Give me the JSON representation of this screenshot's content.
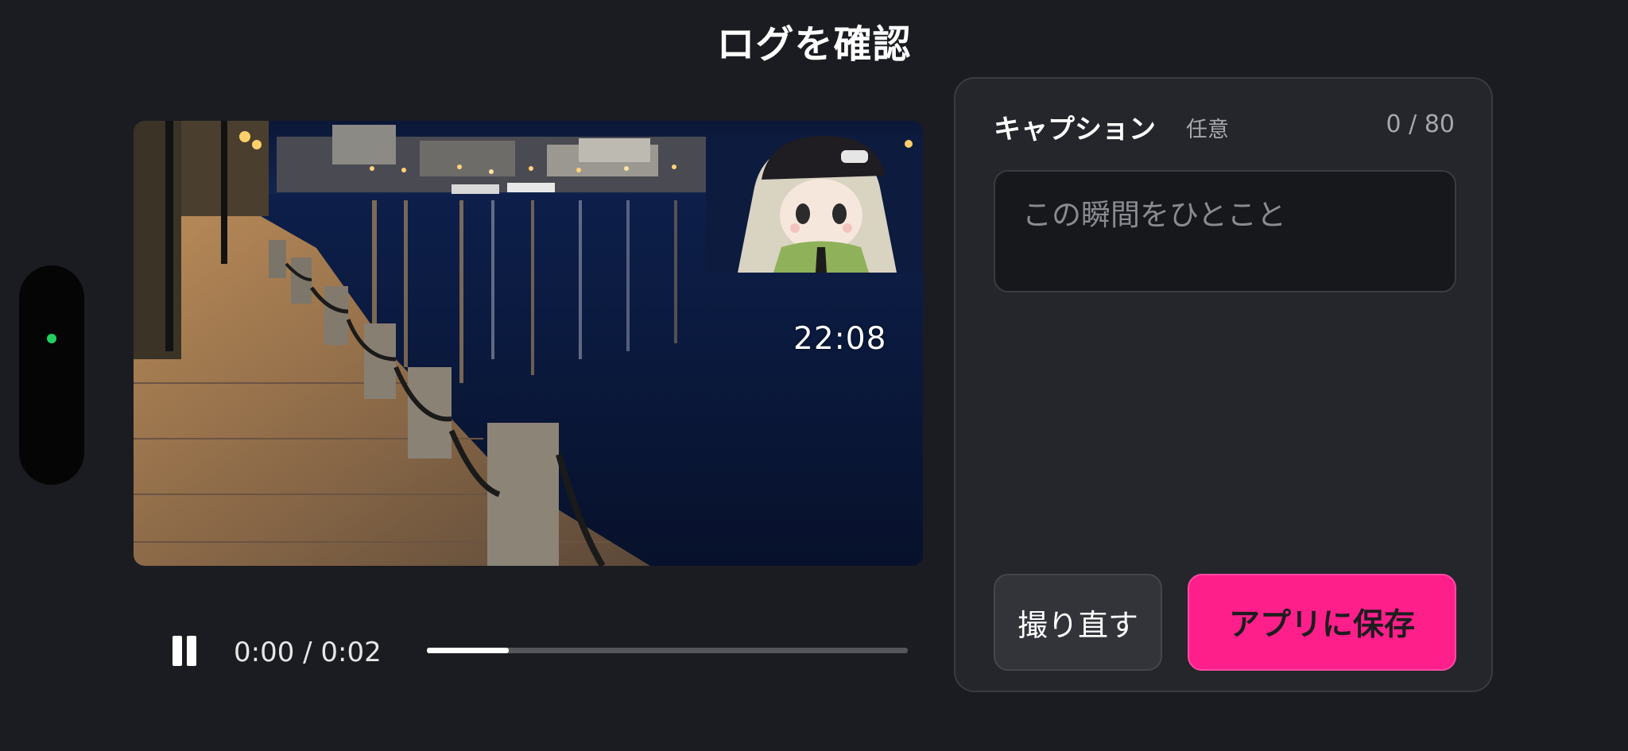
{
  "header": {
    "title": "ログを確認"
  },
  "status": {
    "indicator_color": "#22d061"
  },
  "video": {
    "timestamp_overlay": "22:08",
    "pip_subject": "anime-avatar"
  },
  "player": {
    "pause_icon": "pause-icon",
    "time_display": "0:00 / 0:02",
    "progress_fraction": 0.17
  },
  "caption": {
    "label": "キャプション",
    "optional_label": "任意",
    "counter": "0 / 80",
    "value": "",
    "placeholder": "この瞬間をひとこと"
  },
  "actions": {
    "retake_label": "撮り直す",
    "save_label": "アプリに保存",
    "save_color": "#ff1f8b"
  }
}
